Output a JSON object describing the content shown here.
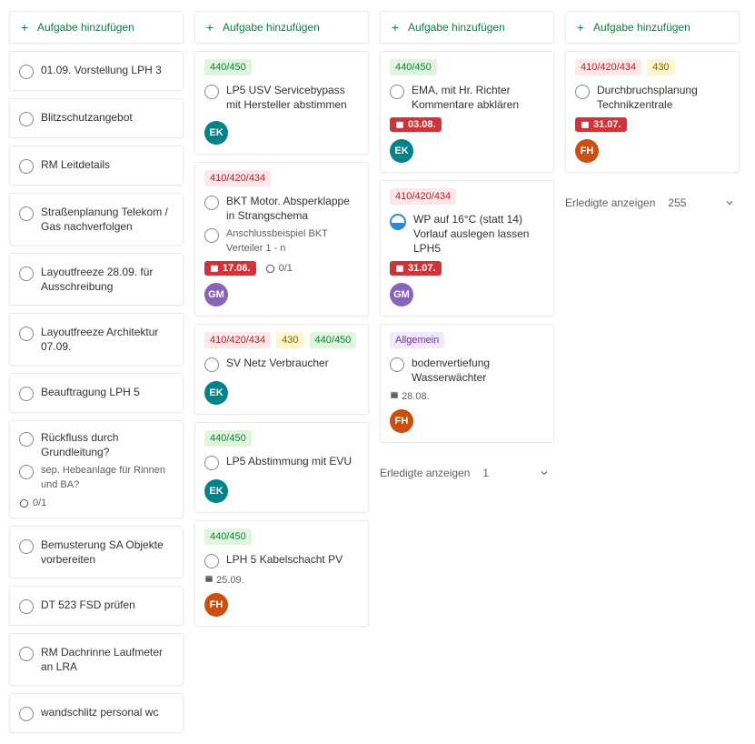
{
  "add_label": "Aufgabe hinzufügen",
  "done_label": "Erledigte anzeigen",
  "columns": [
    {
      "cards": [
        {
          "tasks": [
            {
              "label": "01.09. Vorstellung LPH 3"
            }
          ]
        },
        {
          "tasks": [
            {
              "label": "Blitzschutzangebot"
            }
          ]
        },
        {
          "tasks": [
            {
              "label": "RM Leitdetails"
            }
          ]
        },
        {
          "tasks": [
            {
              "label": "Straßenplanung Telekom / Gas nachverfolgen"
            }
          ]
        },
        {
          "tasks": [
            {
              "label": "Layoutfreeze 28.09. für Ausschreibung"
            }
          ]
        },
        {
          "tasks": [
            {
              "label": "Layoutfreeze Architektur 07.09."
            }
          ]
        },
        {
          "tasks": [
            {
              "label": "Beauftragung LPH 5"
            }
          ]
        },
        {
          "tasks": [
            {
              "label": "Rückfluss durch Grundleitung?"
            },
            {
              "label": "sep. Hebeanlage für Rinnen und BA?",
              "sub": true
            }
          ],
          "progress": "0/1"
        },
        {
          "tasks": [
            {
              "label": "Bemusterung SA Objekte vorbereiten"
            }
          ]
        },
        {
          "tasks": [
            {
              "label": "DT 523 FSD prüfen"
            }
          ]
        },
        {
          "tasks": [
            {
              "label": "RM Dachrinne Laufmeter an LRA"
            }
          ]
        },
        {
          "tasks": [
            {
              "label": "wandschlitz personal wc"
            }
          ]
        }
      ]
    },
    {
      "cards": [
        {
          "badges": [
            {
              "text": "440/450",
              "c": "b-green"
            }
          ],
          "tasks": [
            {
              "label": "LP5 USV Servicebypass mit Hersteller abstimmen"
            }
          ],
          "avatar": {
            "text": "EK",
            "c": "av-teal"
          }
        },
        {
          "badges": [
            {
              "text": "410/420/434",
              "c": "b-pink"
            }
          ],
          "tasks": [
            {
              "label": "BKT Motor. Absperklappe in Strangschema"
            },
            {
              "label": "Anschlussbeispiel BKT Verteiler 1 - n",
              "sub": true
            }
          ],
          "date": "17.06.",
          "progress": "0/1",
          "avatar": {
            "text": "GM",
            "c": "av-purple"
          }
        },
        {
          "badges": [
            {
              "text": "410/420/434",
              "c": "b-pink"
            },
            {
              "text": "430",
              "c": "b-yellow"
            },
            {
              "text": "440/450",
              "c": "b-green"
            }
          ],
          "tasks": [
            {
              "label": "SV Netz Verbraucher"
            }
          ],
          "avatar": {
            "text": "EK",
            "c": "av-teal"
          }
        },
        {
          "badges": [
            {
              "text": "440/450",
              "c": "b-green"
            }
          ],
          "tasks": [
            {
              "label": "LP5 Abstimmung mit EVU"
            }
          ],
          "avatar": {
            "text": "EK",
            "c": "av-teal"
          }
        },
        {
          "badges": [
            {
              "text": "440/450",
              "c": "b-green"
            }
          ],
          "tasks": [
            {
              "label": "LPH 5 Kabelschacht PV"
            }
          ],
          "date_plain": "25.09.",
          "avatar": {
            "text": "FH",
            "c": "av-orange"
          }
        }
      ]
    },
    {
      "cards": [
        {
          "badges": [
            {
              "text": "440/450",
              "c": "b-green"
            }
          ],
          "tasks": [
            {
              "label": "EMA, mit Hr. Richter Kommentare abklären"
            }
          ],
          "date": "03.08.",
          "avatar": {
            "text": "EK",
            "c": "av-teal"
          }
        },
        {
          "badges": [
            {
              "text": "410/420/434",
              "c": "b-pink"
            }
          ],
          "tasks": [
            {
              "label": "WP auf 16°C (statt 14) Vorlauf auslegen lassen LPH5",
              "ring": true
            }
          ],
          "date": "31.07.",
          "avatar": {
            "text": "GM",
            "c": "av-purple"
          }
        },
        {
          "badges": [
            {
              "text": "Allgemein",
              "c": "b-violet"
            }
          ],
          "tasks": [
            {
              "label": "bodenvertiefung Wasserwächter"
            }
          ],
          "date_plain": "28.08.",
          "avatar": {
            "text": "FH",
            "c": "av-orange"
          }
        }
      ],
      "done_count": "1"
    },
    {
      "cards": [
        {
          "badges": [
            {
              "text": "410/420/434",
              "c": "b-pink"
            },
            {
              "text": "430",
              "c": "b-yellow"
            }
          ],
          "tasks": [
            {
              "label": "Durchbruchsplanung Technikzentrale"
            }
          ],
          "date": "31.07.",
          "avatar": {
            "text": "FH",
            "c": "av-orange"
          }
        }
      ],
      "done_count": "255"
    }
  ]
}
